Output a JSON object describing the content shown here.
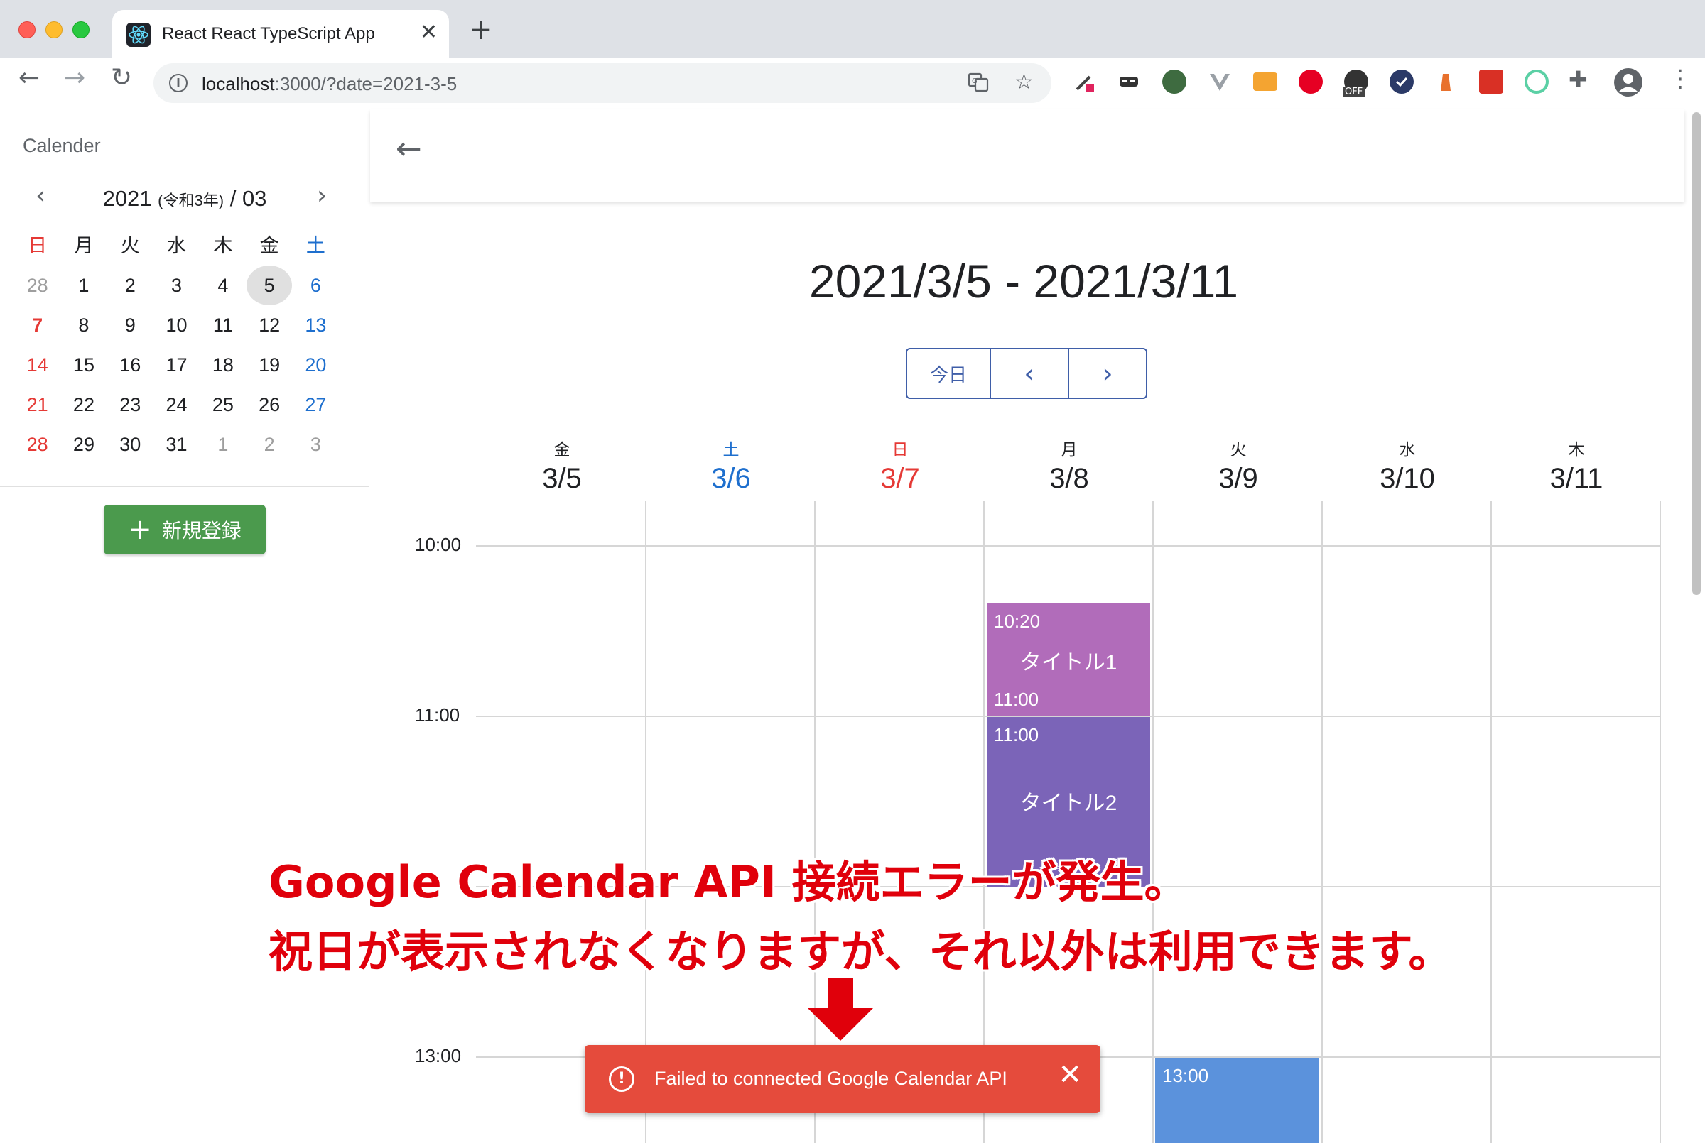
{
  "browser": {
    "tab_title": "React React TypeScript App",
    "url_host": "localhost",
    "url_rest": ":3000/?date=2021-3-5",
    "ext_off_badge": "OFF"
  },
  "sidebar": {
    "title": "Calender",
    "mini_calendar": {
      "year": "2021",
      "era": "(令和3年)",
      "separator": "/",
      "month": "03",
      "weekdays": [
        "日",
        "月",
        "火",
        "水",
        "木",
        "金",
        "土"
      ],
      "weeks": [
        [
          "28",
          "1",
          "2",
          "3",
          "4",
          "5",
          "6"
        ],
        [
          "7",
          "8",
          "9",
          "10",
          "11",
          "12",
          "13"
        ],
        [
          "14",
          "15",
          "16",
          "17",
          "18",
          "19",
          "20"
        ],
        [
          "21",
          "22",
          "23",
          "24",
          "25",
          "26",
          "27"
        ],
        [
          "28",
          "29",
          "30",
          "31",
          "1",
          "2",
          "3"
        ]
      ],
      "selected": "5"
    },
    "new_button_label": "新規登録"
  },
  "main": {
    "week_title": "2021/3/5 - 2021/3/11",
    "nav": {
      "today_label": "今日"
    },
    "days": [
      {
        "weekday": "金",
        "date": "3/5"
      },
      {
        "weekday": "土",
        "date": "3/6"
      },
      {
        "weekday": "日",
        "date": "3/7"
      },
      {
        "weekday": "月",
        "date": "3/8"
      },
      {
        "weekday": "火",
        "date": "3/9"
      },
      {
        "weekday": "水",
        "date": "3/10"
      },
      {
        "weekday": "木",
        "date": "3/11"
      }
    ],
    "time_labels": [
      "10:00",
      "11:00",
      "13:00"
    ],
    "events": [
      {
        "start": "10:20",
        "title": "タイトル1",
        "end": "11:00",
        "color": "#b16cba"
      },
      {
        "start": "11:00",
        "title": "タイトル2",
        "color": "#7b64b8"
      },
      {
        "start": "13:00",
        "color": "#5b92dc"
      }
    ]
  },
  "annotation": {
    "line1": "Google Calendar API 接続エラーが発生。",
    "line2": "祝日が表示されなくなりますが、それ以外は利用できます。"
  },
  "toast": {
    "message": "Failed to connected Google Calendar API",
    "color": "#e54b3c"
  }
}
